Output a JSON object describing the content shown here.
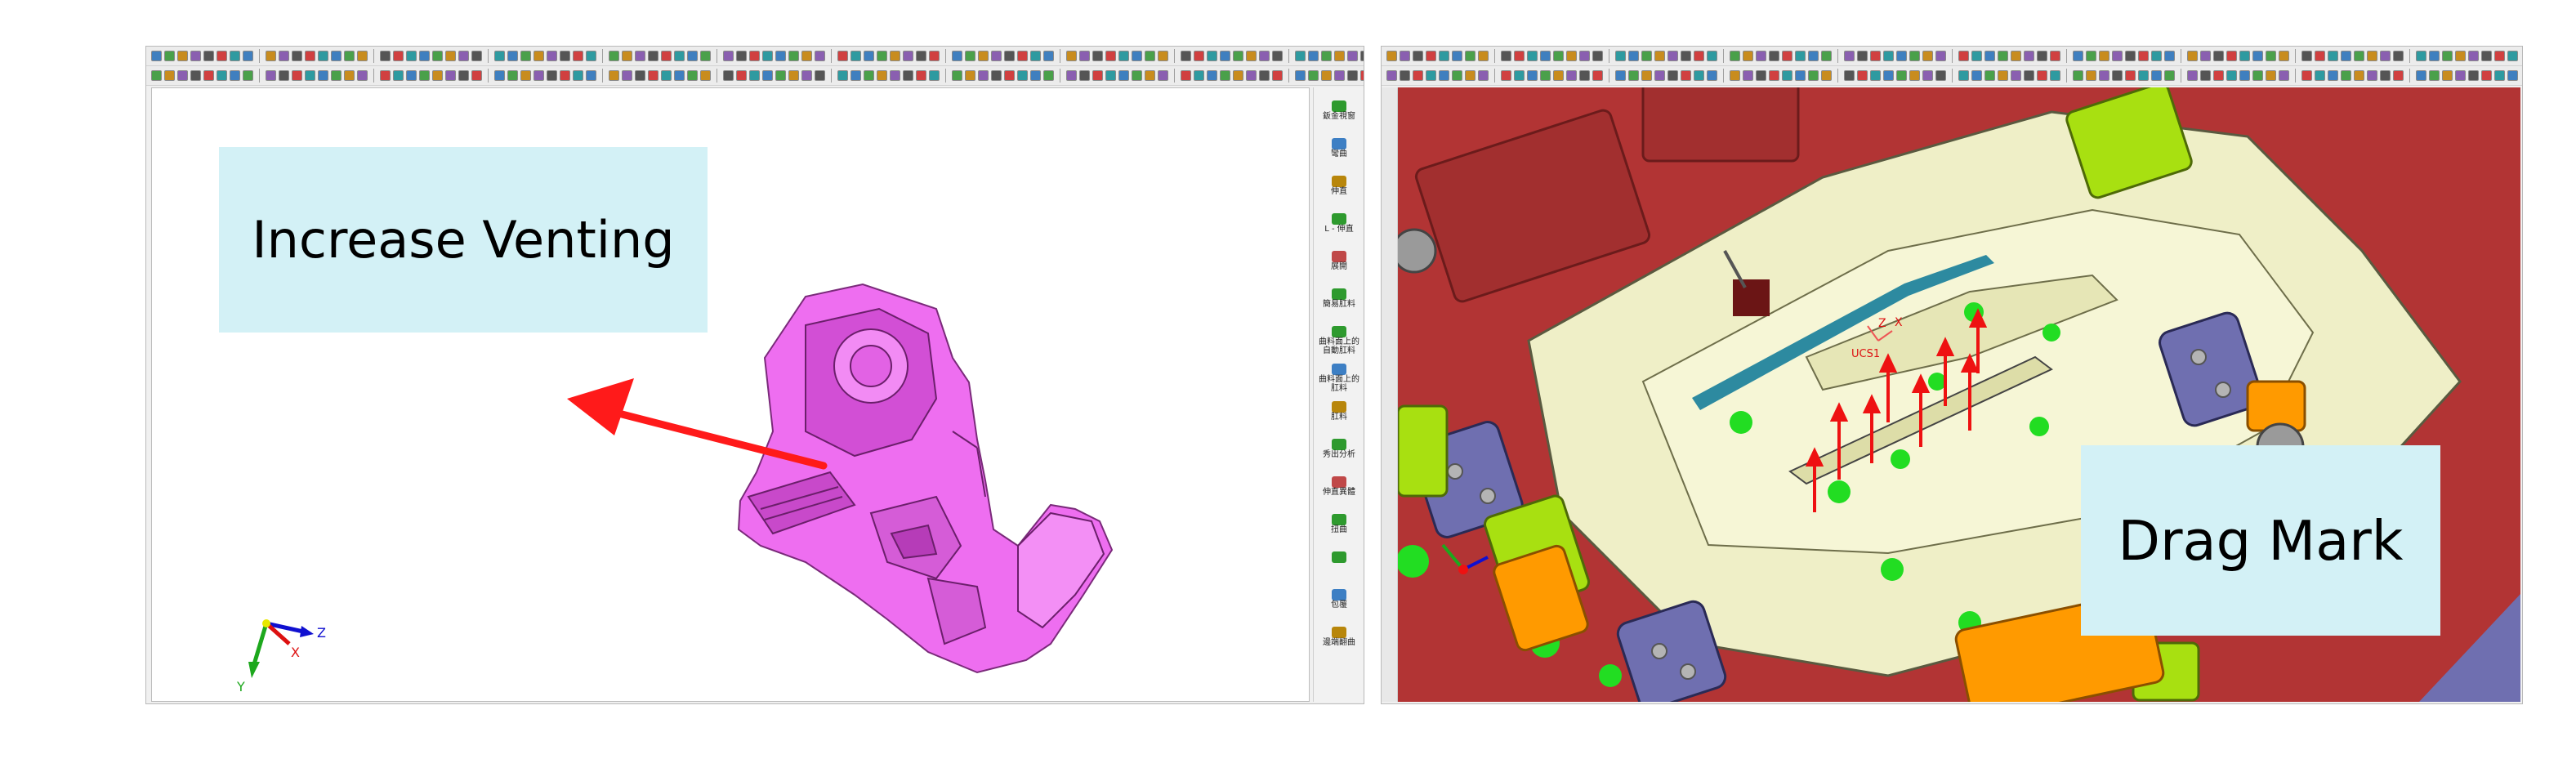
{
  "left_callout": {
    "text": "Increase Venting"
  },
  "right_callout": {
    "text": "Drag Mark"
  },
  "palette": {
    "items": [
      {
        "label": "鈑金視窗",
        "icon": "sheet-metal-view-icon"
      },
      {
        "label": "彎曲",
        "icon": "bend-icon"
      },
      {
        "label": "伸直",
        "icon": "unbend-icon"
      },
      {
        "label": "L - 伸直",
        "icon": "l-unbend-icon"
      },
      {
        "label": "展開",
        "icon": "flatten-icon"
      },
      {
        "label": "簡易肛料",
        "icon": "simple-blank-icon"
      },
      {
        "label": "曲料面上的",
        "label2": "自動肛料",
        "icon": "auto-blank-icon"
      },
      {
        "label": "曲料面上的",
        "label2": "肛料",
        "icon": "surface-blank-icon"
      },
      {
        "label": "肛料",
        "icon": "blank-icon"
      },
      {
        "label": "秀出分析",
        "icon": "show-analysis-icon"
      },
      {
        "label": "伸直異體",
        "icon": "unbend-body-icon"
      },
      {
        "label": "扭曲",
        "icon": "twist-icon"
      },
      {
        "label": "",
        "icon": "dropdown-tool-icon"
      },
      {
        "label": "包覆",
        "icon": "wrap-icon"
      },
      {
        "label": "邊端翻曲",
        "icon": "edge-flange-icon"
      }
    ]
  },
  "left_axes": {
    "z": "Z",
    "x": "X",
    "y": "Y"
  },
  "right_ucs": {
    "label": "UCS1",
    "z": "Z",
    "x": "X"
  },
  "colors": {
    "part": "#ee6ef0",
    "arrow": "#ff1a1a",
    "mold_base": "#b23434",
    "cavity_insert": "#efefc7",
    "callout_bg": "#d3f1f6",
    "green_marker": "#22dd22",
    "bolt_block_purple": "#6f6fb0",
    "slide_green": "#a8e011",
    "slide_orange": "#ff9a00"
  }
}
